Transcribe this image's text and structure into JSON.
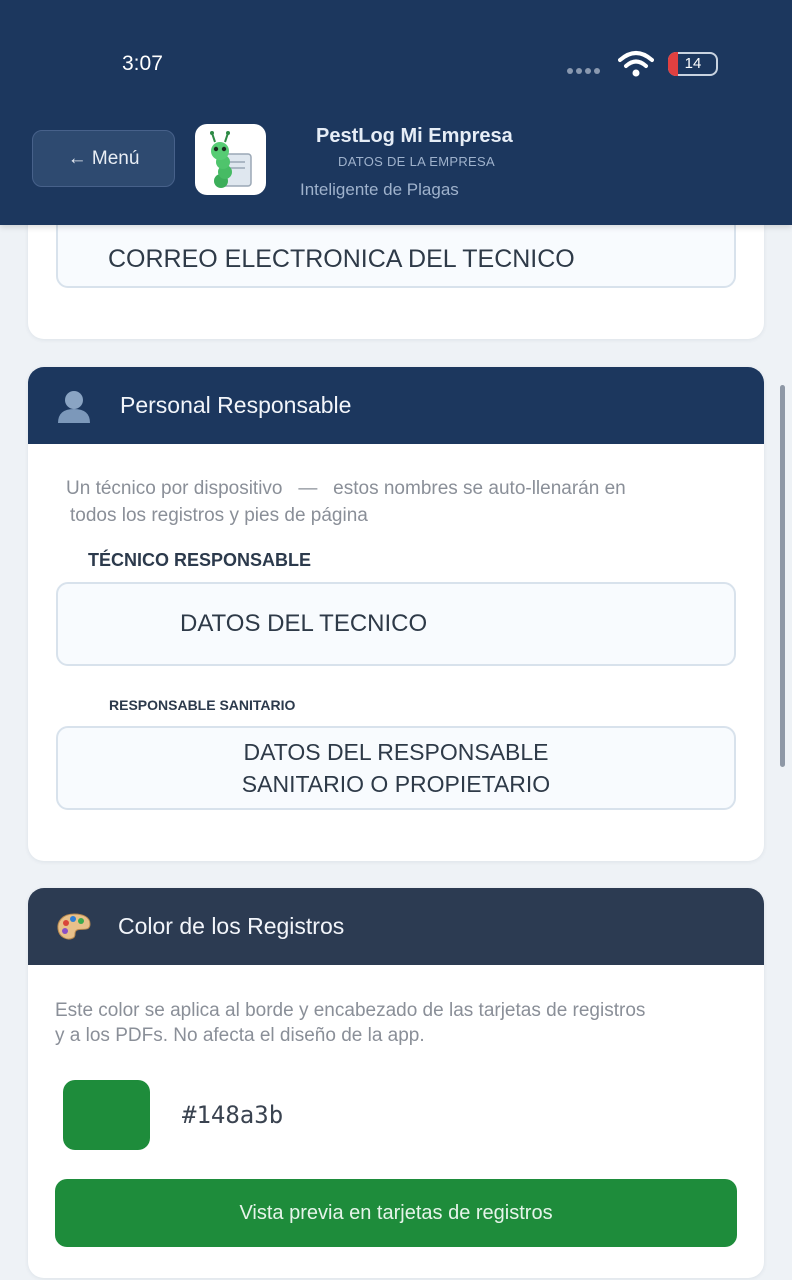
{
  "status_bar": {
    "time": "3:07",
    "battery": "14"
  },
  "header": {
    "menu_label": "← Menú",
    "app_title": "PestLog Mi Empresa",
    "app_subtitle": "DATOS DE LA EMPRESA",
    "app_tagline": "Inteligente de Plagas"
  },
  "email_card": {
    "email_value": "CORREO ELECTRONICA DEL TECNICO"
  },
  "personal_card": {
    "title": "Personal Responsable",
    "hint_line1": "Un técnico por dispositivo   —   estos nombres se auto-llenarán en",
    "hint_line2": "todos los registros y pies de página",
    "tecnico_label": "TÉCNICO RESPONSABLE",
    "tecnico_value": "DATOS DEL TECNICO",
    "sanitario_label": "RESPONSABLE SANITARIO",
    "sanitario_value": "DATOS DEL RESPONSABLE SANITARIO O PROPIETARIO"
  },
  "color_card": {
    "title": "Color de los Registros",
    "hint": "Este color se aplica al borde y encabezado de las tarjetas de registros y a los PDFs. No afecta el diseño de la app.",
    "hex_value": "#148a3b",
    "preview_label": "Vista previa en tarjetas de registros"
  },
  "colors": {
    "header_bg": "#1c375e",
    "personal_head_bg": "#1c375e",
    "color_head_bg": "#2c3b52",
    "swatch": "#1e8c3b",
    "preview_button_bg": "#1e8c3b"
  }
}
